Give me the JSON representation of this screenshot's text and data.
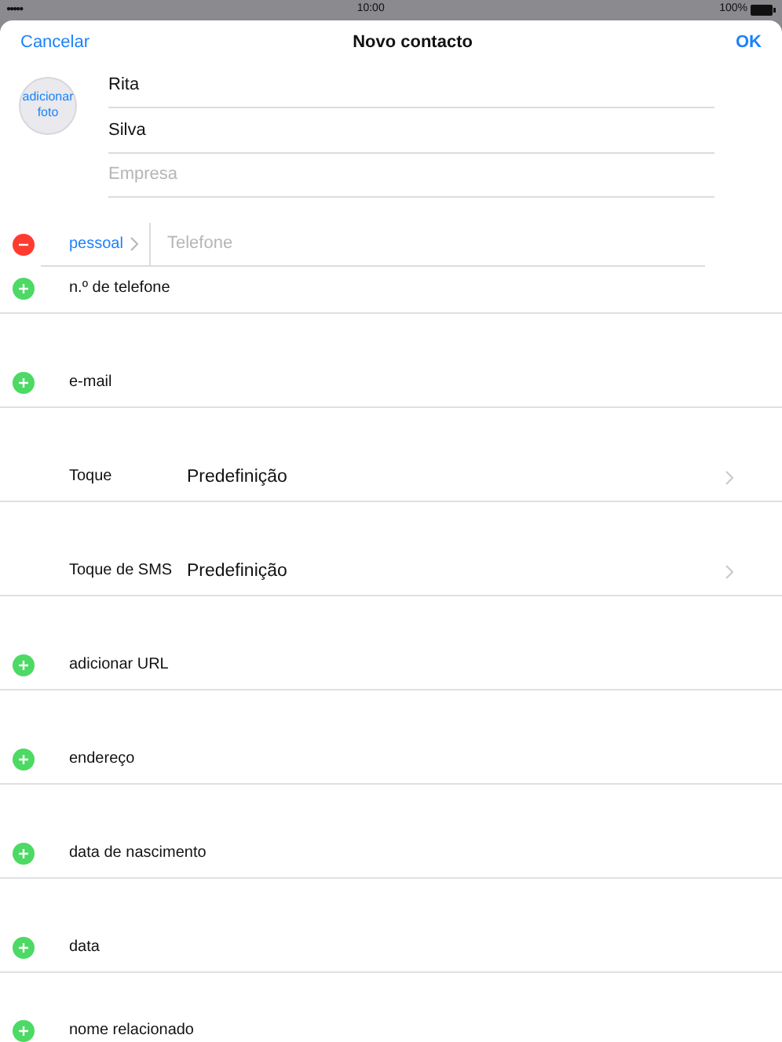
{
  "status_bar": {
    "signal": "●●●●●",
    "time": "10:00",
    "battery": "100%"
  },
  "nav": {
    "cancel": "Cancelar",
    "title": "Novo contacto",
    "ok": "OK"
  },
  "photo": {
    "label": "adicionar foto"
  },
  "name_fields": [
    {
      "value": "Rita"
    },
    {
      "value": "Silva"
    },
    {
      "placeholder": "Empresa"
    }
  ],
  "phone": {
    "label": "pessoal",
    "placeholder": "Telefone"
  },
  "rows": [
    {
      "kind": "add",
      "label": "n.º de telefone"
    },
    {
      "kind": "add",
      "label": "e-mail"
    },
    {
      "kind": "setting",
      "label": "Toque",
      "value": "Predefinição"
    },
    {
      "kind": "setting",
      "label": "Toque de SMS",
      "value": "Predefinição"
    },
    {
      "kind": "add",
      "label": "adicionar URL"
    },
    {
      "kind": "add",
      "label": "endereço"
    },
    {
      "kind": "add",
      "label": "data de nascimento"
    },
    {
      "kind": "add",
      "label": "data"
    },
    {
      "kind": "add",
      "label": "nome relacionado"
    }
  ]
}
